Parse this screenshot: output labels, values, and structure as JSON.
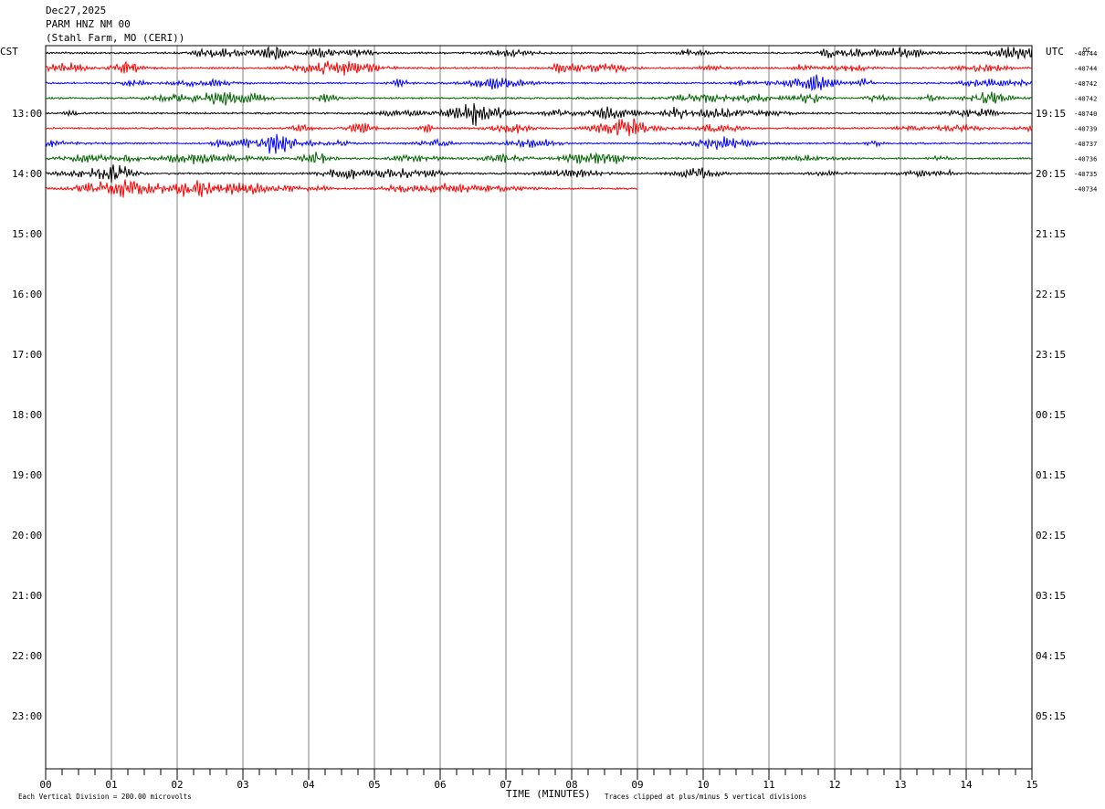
{
  "header": {
    "date": "Dec27,2025",
    "station": "PARM HNZ NM 00",
    "location": "(Stahl Farm, MO (CERI))"
  },
  "axes": {
    "left_label": "CST",
    "right_label": "UTC",
    "dc_label": "DC",
    "x_title": "TIME (MINUTES)"
  },
  "footer": {
    "left_note": "Each Vertical Division =  200.00 microvolts",
    "right_note": "Traces clipped at plus/minus 5 vertical divisions"
  },
  "chart_data": {
    "type": "line",
    "title": "PARM HNZ NM 00",
    "xlabel": "TIME (MINUTES)",
    "xlim": [
      0,
      15
    ],
    "x_ticks": [
      "00",
      "01",
      "02",
      "03",
      "04",
      "05",
      "06",
      "07",
      "08",
      "09",
      "10",
      "11",
      "12",
      "13",
      "14",
      "15"
    ],
    "grid": "vertical lines every minute",
    "cst_hour_labels": [
      "13:00",
      "14:00",
      "15:00",
      "16:00",
      "17:00",
      "18:00",
      "19:00",
      "20:00",
      "21:00",
      "22:00",
      "23:00"
    ],
    "utc_hour_labels": [
      "19:15",
      "20:15",
      "21:15",
      "22:15",
      "23:15",
      "00:15",
      "01:15",
      "02:15",
      "03:15",
      "04:15",
      "05:15"
    ],
    "trace_colors": [
      "#000000",
      "#ff0000",
      "#0000ff",
      "#006400"
    ],
    "traces": [
      {
        "row": 0,
        "color": "#000000",
        "dc": "-40744",
        "end_minute": 15
      },
      {
        "row": 1,
        "color": "#ff0000",
        "dc": "-40744",
        "end_minute": 15
      },
      {
        "row": 2,
        "color": "#0000ff",
        "dc": "-40742",
        "end_minute": 15
      },
      {
        "row": 3,
        "color": "#006400",
        "dc": "-40742",
        "end_minute": 15
      },
      {
        "row": 4,
        "color": "#000000",
        "dc": "-40740",
        "end_minute": 15
      },
      {
        "row": 5,
        "color": "#ff0000",
        "dc": "-40739",
        "end_minute": 15
      },
      {
        "row": 6,
        "color": "#0000ff",
        "dc": "-40737",
        "end_minute": 15
      },
      {
        "row": 7,
        "color": "#006400",
        "dc": "-40736",
        "end_minute": 15
      },
      {
        "row": 8,
        "color": "#000000",
        "dc": "-40735",
        "end_minute": 15
      },
      {
        "row": 9,
        "color": "#ff0000",
        "dc": "-40734",
        "end_minute": 9
      }
    ],
    "microvolts_per_division": 200.0
  }
}
